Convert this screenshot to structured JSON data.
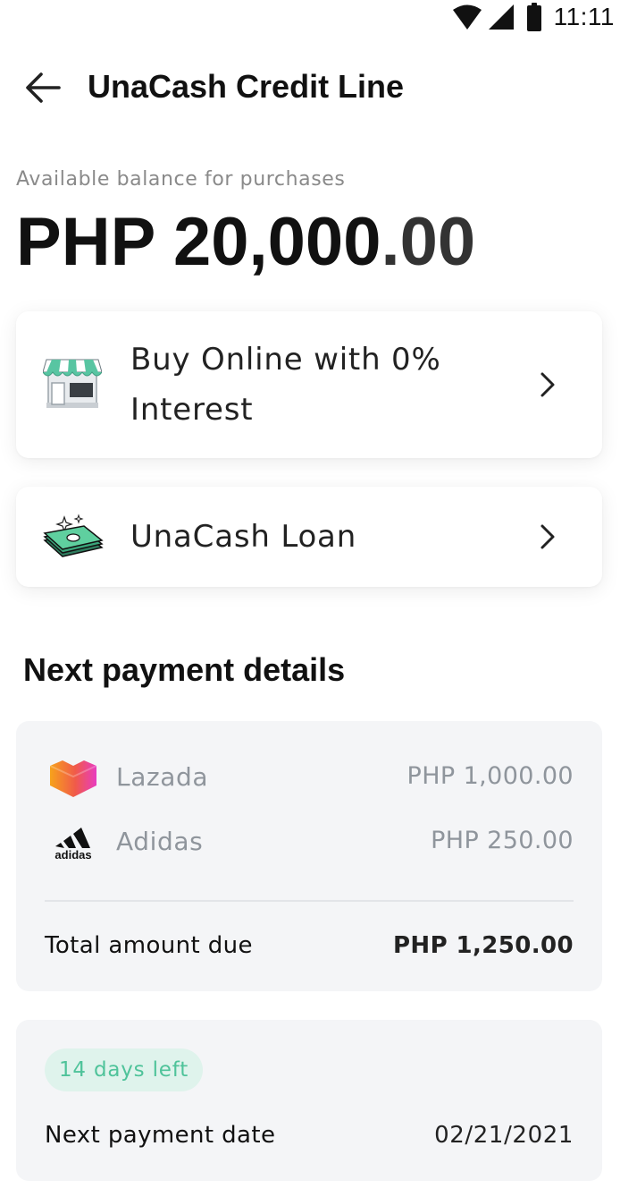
{
  "status_bar": {
    "time": "11:11",
    "icons": [
      "wifi-icon",
      "cellular-signal-icon",
      "battery-icon"
    ]
  },
  "header": {
    "title": "UnaCash Credit Line",
    "back_icon": "arrow-left-icon"
  },
  "balance": {
    "label": "Available balance for purchases",
    "amount_main": "PHP 20,000",
    "amount_decimals": ".00"
  },
  "actions": [
    {
      "label": "Buy Online with 0% Interest",
      "icon": "storefront-icon"
    },
    {
      "label": "UnaCash Loan",
      "icon": "cash-stack-icon"
    }
  ],
  "payment_details": {
    "title": "Next payment details",
    "items": [
      {
        "merchant": "Lazada",
        "amount": "PHP 1,000.00",
        "logo": "lazada-logo"
      },
      {
        "merchant": "Adidas",
        "amount": "PHP 250.00",
        "logo": "adidas-logo",
        "logo_text": "adidas"
      }
    ],
    "total_label": "Total amount due",
    "total_amount": "PHP 1,250.00"
  },
  "next_payment": {
    "days_left": "14 days left",
    "date_label": "Next payment date",
    "date_value": "02/21/2021"
  },
  "colors": {
    "accent_green": "#4fc39a",
    "badge_bg": "#dff3ec",
    "panel_bg": "#f4f5f7",
    "muted_text": "#8f959c"
  }
}
